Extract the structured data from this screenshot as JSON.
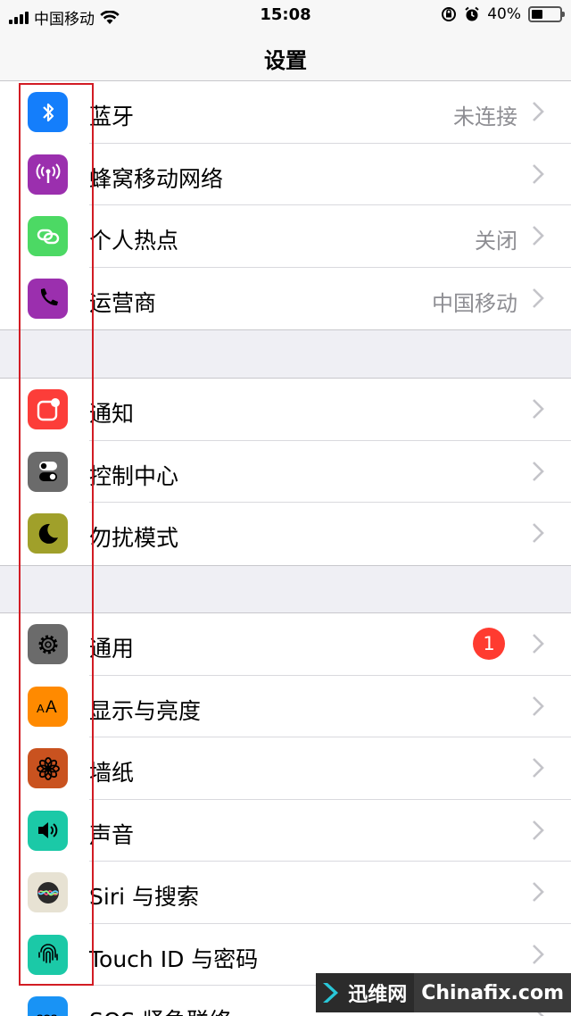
{
  "status_bar": {
    "carrier": "中国移动",
    "time": "15:08",
    "battery_percent": "40%",
    "battery_level": 0.4,
    "icons": [
      "signal-icon",
      "wifi-icon",
      "orientation-lock-icon",
      "alarm-icon",
      "battery-icon"
    ]
  },
  "nav": {
    "title": "设置"
  },
  "groups": [
    {
      "rows": [
        {
          "label": "蓝牙",
          "detail": "未连接",
          "icon": "bluetooth-icon",
          "color": "#147efb"
        },
        {
          "label": "蜂窝移动网络",
          "detail": "",
          "icon": "cellular-icon",
          "color": "#9b2fae"
        },
        {
          "label": "个人热点",
          "detail": "关闭",
          "icon": "hotspot-icon",
          "color": "#4cd964"
        },
        {
          "label": "运营商",
          "detail": "中国移动",
          "icon": "phone-icon",
          "color": "#9b2fae"
        }
      ]
    },
    {
      "rows": [
        {
          "label": "通知",
          "detail": "",
          "icon": "notifications-icon",
          "color": "#fc3d39"
        },
        {
          "label": "控制中心",
          "detail": "",
          "icon": "control-center-icon",
          "color": "#6b6b6b"
        },
        {
          "label": "勿扰模式",
          "detail": "",
          "icon": "moon-icon",
          "color": "#a0a02a"
        }
      ]
    },
    {
      "rows": [
        {
          "label": "通用",
          "detail": "",
          "badge": "1",
          "icon": "gear-icon",
          "color": "#6b6b6b"
        },
        {
          "label": "显示与亮度",
          "detail": "",
          "icon": "display-icon",
          "color": "#ff8a00"
        },
        {
          "label": "墙纸",
          "detail": "",
          "icon": "wallpaper-icon",
          "color": "#c9521f"
        },
        {
          "label": "声音",
          "detail": "",
          "icon": "speaker-icon",
          "color": "#1bc9a7"
        },
        {
          "label": "Siri 与搜索",
          "detail": "",
          "icon": "siri-icon",
          "color": "#e7e2d3"
        },
        {
          "label": "Touch ID 与密码",
          "detail": "",
          "icon": "fingerprint-icon",
          "color": "#1bc9a7"
        },
        {
          "label": "SOS 紧急联络",
          "detail": "",
          "icon": "sos-icon",
          "color": "#1993f5"
        }
      ]
    }
  ],
  "watermark": {
    "left": "迅维网",
    "right": "Chinafix.com"
  }
}
